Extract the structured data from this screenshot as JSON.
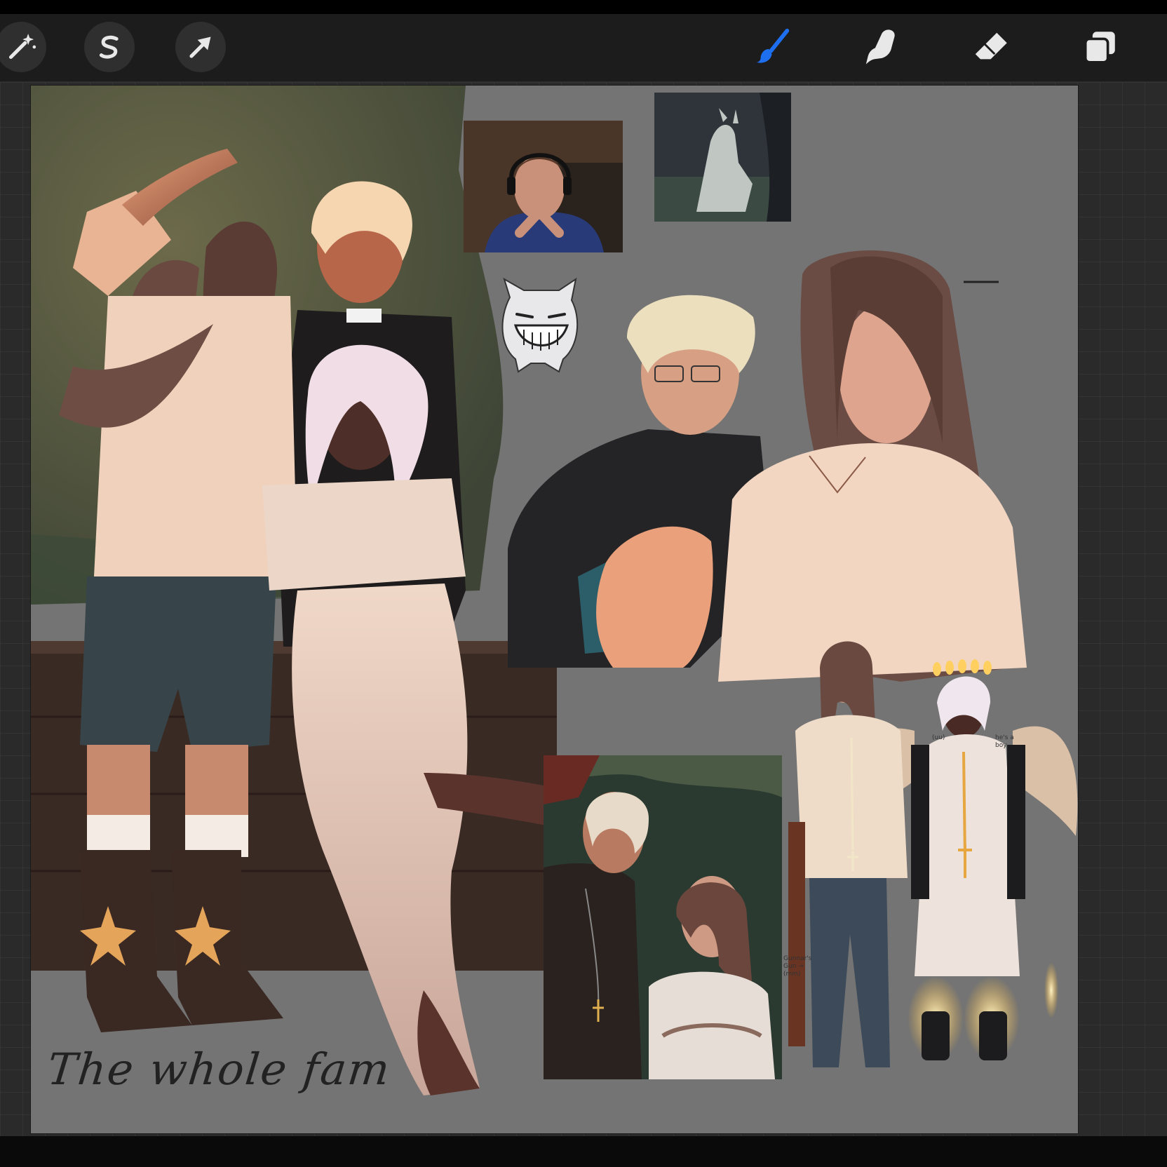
{
  "toolbar": {
    "left_tools": [
      {
        "name": "adjustments",
        "icon": "magic-wand-icon"
      },
      {
        "name": "selection",
        "icon": "selection-s-icon"
      },
      {
        "name": "transform",
        "icon": "arrow-cursor-icon"
      }
    ],
    "right_tools": [
      {
        "name": "brush",
        "icon": "brush-icon",
        "active": true
      },
      {
        "name": "smudge",
        "icon": "smudge-finger-icon"
      },
      {
        "name": "eraser",
        "icon": "eraser-icon"
      },
      {
        "name": "layers",
        "icon": "layers-icon"
      }
    ],
    "active_color": "#1e6ff0"
  },
  "canvas": {
    "background_color": "#747474",
    "caption": "The whole fam"
  },
  "references": {
    "webcam": "streamer-webcam-overlay",
    "wolf_image": "werewolf-reference-image",
    "sticker": "grinning-cat-sticker"
  },
  "side_notes": {
    "left_note": "Gunnar's Gun → (mm)",
    "bubble_left": "(uu)",
    "bubble_right": "he's a boy"
  }
}
